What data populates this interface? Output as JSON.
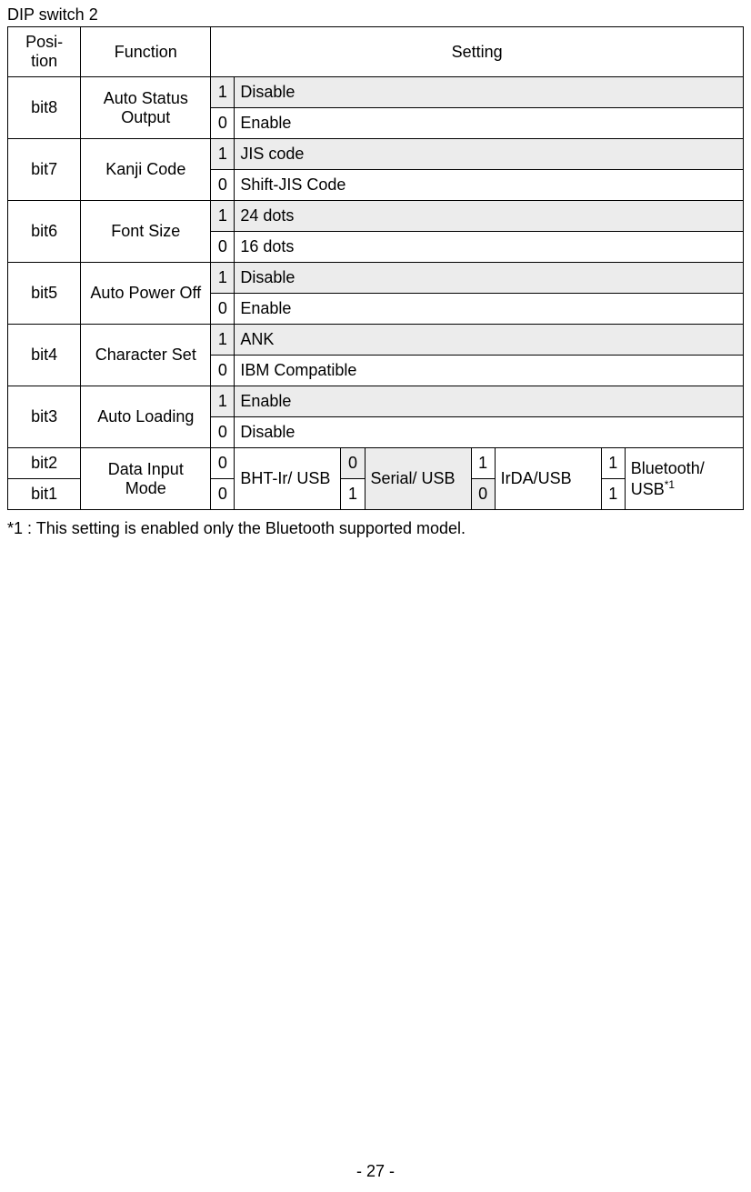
{
  "title": "DIP switch 2",
  "headers": {
    "position": "Posi-\ntion",
    "function": "Function",
    "setting": "Setting"
  },
  "rows": [
    {
      "pos": "bit8",
      "func": "Auto Status Output",
      "opts": [
        {
          "bit": "1",
          "label": "Disable",
          "shade": true
        },
        {
          "bit": "0",
          "label": "Enable",
          "shade": false
        }
      ]
    },
    {
      "pos": "bit7",
      "func": "Kanji Code",
      "opts": [
        {
          "bit": "1",
          "label": "JIS code",
          "shade": true
        },
        {
          "bit": "0",
          "label": "Shift-JIS Code",
          "shade": false
        }
      ]
    },
    {
      "pos": "bit6",
      "func": "Font Size",
      "opts": [
        {
          "bit": "1",
          "label": "24 dots",
          "shade": true
        },
        {
          "bit": "0",
          "label": "16 dots",
          "shade": false
        }
      ]
    },
    {
      "pos": "bit5",
      "func": "Auto Power Off",
      "opts": [
        {
          "bit": "1",
          "label": "Disable",
          "shade": true
        },
        {
          "bit": "0",
          "label": "Enable",
          "shade": false
        }
      ]
    },
    {
      "pos": "bit4",
      "func": "Character Set",
      "opts": [
        {
          "bit": "1",
          "label": "ANK",
          "shade": true
        },
        {
          "bit": "0",
          "label": "IBM Compatible",
          "shade": false
        }
      ]
    },
    {
      "pos": "bit3",
      "func": "Auto Loading",
      "opts": [
        {
          "bit": "1",
          "label": "Enable",
          "shade": true
        },
        {
          "bit": "0",
          "label": "Disable",
          "shade": false
        }
      ]
    }
  ],
  "modeRow": {
    "pos2": "bit2",
    "pos1": "bit1",
    "func": "Data Input Mode",
    "modes": [
      {
        "top": "0",
        "bot": "0",
        "label": "BHT-Ir/ USB",
        "shadeTop": false,
        "shadeBot": false
      },
      {
        "top": "0",
        "bot": "1",
        "label": "Serial/ USB",
        "shadeTop": true,
        "shadeBot": false
      },
      {
        "top": "1",
        "bot": "0",
        "label": "IrDA/USB",
        "shadeTop": false,
        "shadeBot": true
      },
      {
        "top": "1",
        "bot": "1",
        "label": "Bluetooth/ USB",
        "shadeTop": false,
        "shadeBot": false,
        "sup": "*1"
      }
    ]
  },
  "footnote": "*1 : This setting is enabled only the Bluetooth supported model.",
  "pageNumber": "- 27 -"
}
